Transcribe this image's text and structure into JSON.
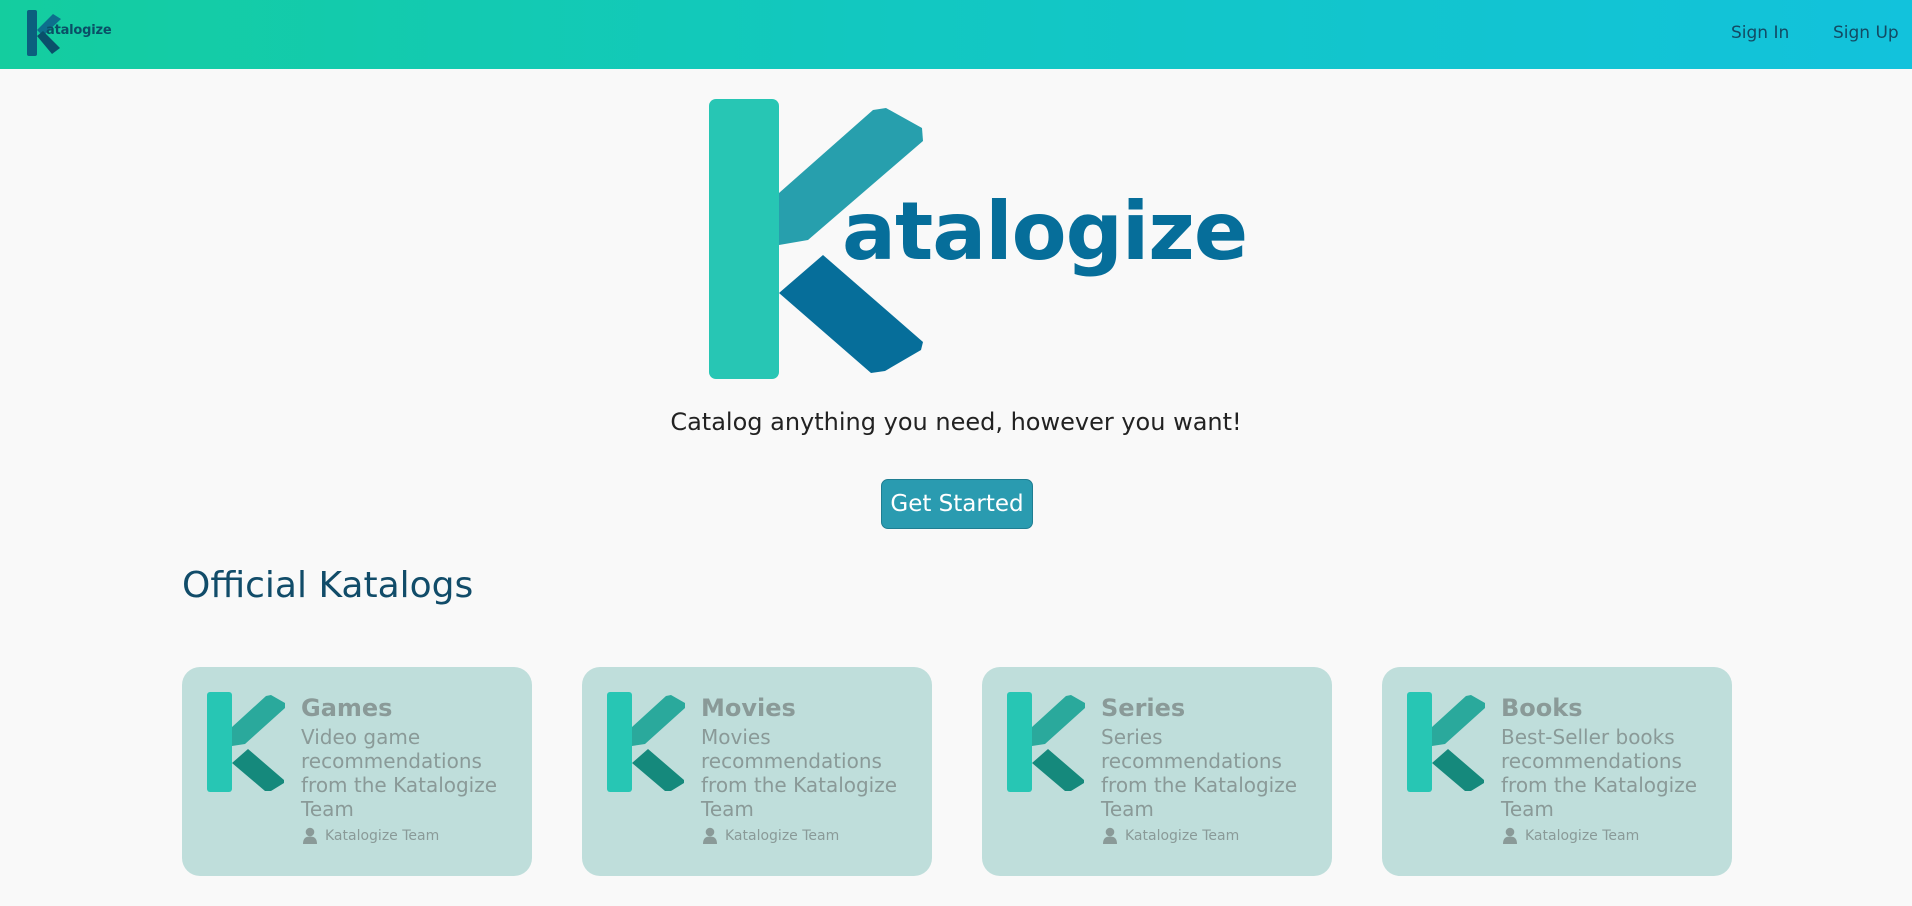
{
  "navbar": {
    "logo_word": "atalogize",
    "sign_in": "Sign In",
    "sign_up": "Sign Up"
  },
  "hero": {
    "logo_word": "atalogize",
    "tagline": "Catalog anything you need, however you want!",
    "cta_label": "Get Started"
  },
  "section": {
    "title": "Official Katalogs"
  },
  "cards": [
    {
      "title": "Games",
      "description": "Video game recommendations from the Katalogize Team",
      "author": "Katalogize Team"
    },
    {
      "title": "Movies",
      "description": "Movies recommendations from the Katalogize Team",
      "author": "Katalogize Team"
    },
    {
      "title": "Series",
      "description": "Series recommendations from the Katalogize Team",
      "author": "Katalogize Team"
    },
    {
      "title": "Books",
      "description": "Best-Seller books recommendations from the Katalogize Team",
      "author": "Katalogize Team"
    }
  ],
  "colors": {
    "navbar_gradient_start": "#14cd9f",
    "navbar_gradient_end": "#12c2dc",
    "brand_dark": "#066e9a",
    "brand_teal": "#27c6b4",
    "cta_background": "#2a9bb0",
    "card_background": "#bfdedb"
  }
}
